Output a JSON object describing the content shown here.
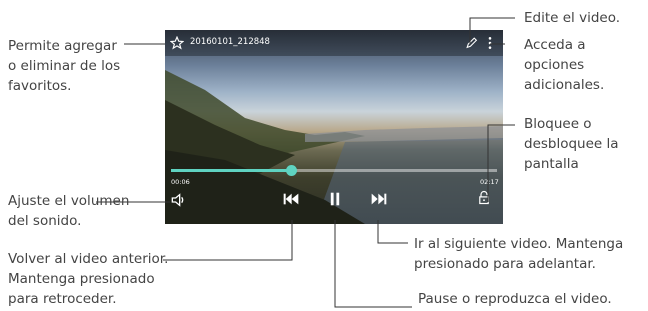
{
  "video": {
    "filename": "20160101_212848",
    "elapsed": "00:06",
    "total": "02:17",
    "progress": 0.37
  },
  "icons": [
    "star-icon",
    "pencil-icon",
    "more-vertical-icon",
    "lock-icon",
    "volume-icon",
    "previous-icon",
    "pause-icon",
    "next-icon"
  ],
  "accent_color": "#5fd3c1",
  "annotations": {
    "favorites": [
      "Permite agregar",
      "o eliminar de los",
      "favoritos."
    ],
    "edit": "Edite el video.",
    "more": [
      "Acceda a",
      "opciones",
      "adicionales."
    ],
    "lock": [
      "Bloquee o",
      "desbloquee la",
      "pantalla"
    ],
    "volume": [
      "Ajuste el volumen",
      "del sonido."
    ],
    "previous": [
      "Volver al video anterior.",
      "Mantenga presionado",
      "para retroceder."
    ],
    "next": [
      "Ir al siguiente video. Mantenga",
      "presionado para adelantar."
    ],
    "pause": "Pause o reproduzca el video."
  }
}
